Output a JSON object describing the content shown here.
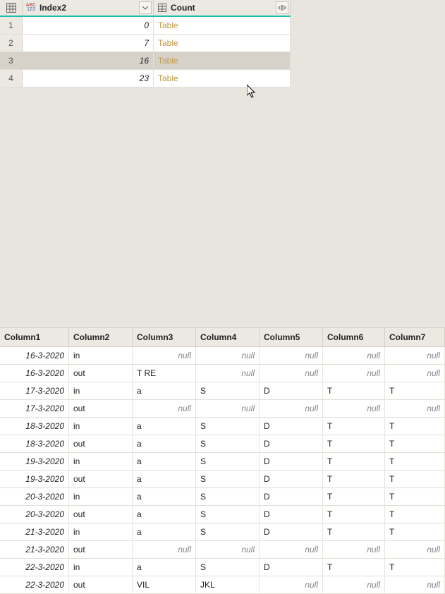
{
  "topTable": {
    "columns": [
      {
        "name": "Index2",
        "type": "ABC123"
      },
      {
        "name": "Count",
        "type": "table"
      }
    ],
    "rows": [
      {
        "num": "1",
        "index": "0",
        "count": "Table",
        "selected": false
      },
      {
        "num": "2",
        "index": "7",
        "count": "Table",
        "selected": false
      },
      {
        "num": "3",
        "index": "16",
        "count": "Table",
        "selected": true
      },
      {
        "num": "4",
        "index": "23",
        "count": "Table",
        "selected": false
      }
    ]
  },
  "bottomTable": {
    "columns": [
      "Column1",
      "Column2",
      "Column3",
      "Column4",
      "Column5",
      "Column6",
      "Column7"
    ],
    "rows": [
      [
        "16-3-2020",
        "in",
        null,
        null,
        null,
        null,
        null
      ],
      [
        "16-3-2020",
        "out",
        "T RE",
        null,
        null,
        null,
        null
      ],
      [
        "17-3-2020",
        "in",
        "a",
        "S",
        "D",
        "T",
        "T"
      ],
      [
        "17-3-2020",
        "out",
        null,
        null,
        null,
        null,
        null
      ],
      [
        "18-3-2020",
        "in",
        "a",
        "S",
        "D",
        "T",
        "T"
      ],
      [
        "18-3-2020",
        "out",
        "a",
        "S",
        "D",
        "T",
        "T"
      ],
      [
        "19-3-2020",
        "in",
        "a",
        "S",
        "D",
        "T",
        "T"
      ],
      [
        "19-3-2020",
        "out",
        "a",
        "S",
        "D",
        "T",
        "T"
      ],
      [
        "20-3-2020",
        "in",
        "a",
        "S",
        "D",
        "T",
        "T"
      ],
      [
        "20-3-2020",
        "out",
        "a",
        "S",
        "D",
        "T",
        "T"
      ],
      [
        "21-3-2020",
        "in",
        "a",
        "S",
        "D",
        "T",
        "T"
      ],
      [
        "21-3-2020",
        "out",
        null,
        null,
        null,
        null,
        null
      ],
      [
        "22-3-2020",
        "in",
        "a",
        "S",
        "D",
        "T",
        "T"
      ],
      [
        "22-3-2020",
        "out",
        "VIL",
        "JKL",
        null,
        null,
        null
      ]
    ]
  },
  "nullLabel": "null"
}
